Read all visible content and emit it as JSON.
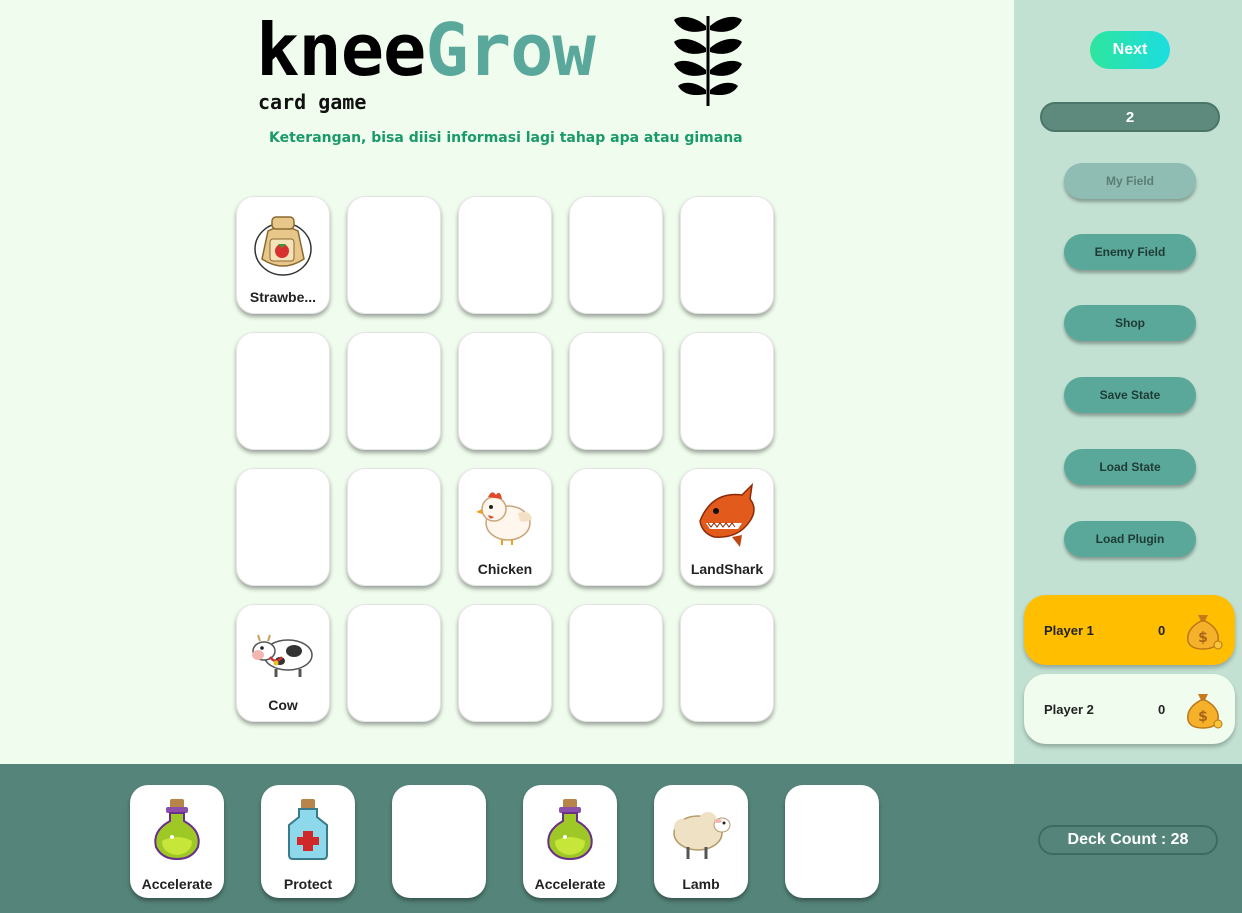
{
  "header": {
    "logo_part1": "knee",
    "logo_part2": "Grow",
    "subtitle": "card game",
    "info_text": "Keterangan, bisa diisi informasi lagi tahap apa atau gimana",
    "logo_icon": "wheat-icon"
  },
  "field": {
    "rows": 4,
    "cols": 5,
    "cards": [
      {
        "row": 0,
        "col": 0,
        "label": "Strawbe...",
        "icon": "seed-bag-icon"
      },
      {
        "row": 2,
        "col": 2,
        "label": "Chicken",
        "icon": "chicken-icon"
      },
      {
        "row": 2,
        "col": 4,
        "label": "LandShark",
        "icon": "shark-icon"
      },
      {
        "row": 3,
        "col": 0,
        "label": "Cow",
        "icon": "cow-icon"
      }
    ]
  },
  "sidebar": {
    "next_label": "Next",
    "turn": "2",
    "buttons": [
      {
        "label": "My Field",
        "disabled": true
      },
      {
        "label": "Enemy Field",
        "disabled": false
      },
      {
        "label": "Shop",
        "disabled": false
      },
      {
        "label": "Save State",
        "disabled": false
      },
      {
        "label": "Load State",
        "disabled": false
      },
      {
        "label": "Load Plugin",
        "disabled": false
      }
    ],
    "players": [
      {
        "name": "Player 1",
        "money": "0",
        "active": true,
        "color": "#ffbf00"
      },
      {
        "name": "Player 2",
        "money": "0",
        "active": false,
        "color": "#f0fdee"
      }
    ]
  },
  "hand": {
    "cards": [
      {
        "label": "Accelerate",
        "icon": "potion-green-icon"
      },
      {
        "label": "Protect",
        "icon": "potion-blue-icon"
      },
      {
        "label": "",
        "icon": ""
      },
      {
        "label": "Accelerate",
        "icon": "potion-green-icon"
      },
      {
        "label": "Lamb",
        "icon": "sheep-icon"
      },
      {
        "label": "",
        "icon": ""
      }
    ],
    "deck_count_label": "Deck Count : 28"
  },
  "colors": {
    "main_bg": "#f0fdee",
    "sidebar_bg": "#c2e1d3",
    "hand_bg": "#55857a",
    "accent": "#5aa89c",
    "active_player": "#ffbf00"
  }
}
